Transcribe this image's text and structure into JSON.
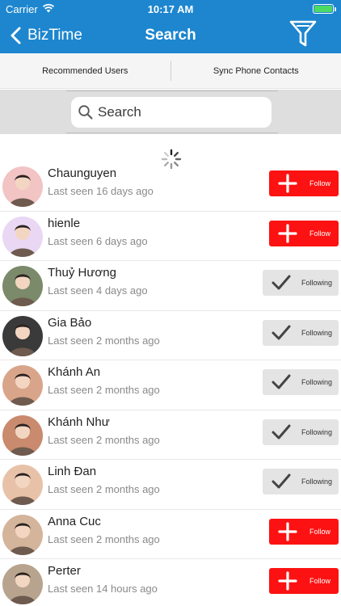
{
  "status_bar": {
    "carrier": "Carrier",
    "time": "10:17 AM"
  },
  "nav": {
    "back_label": "BizTime",
    "title": "Search"
  },
  "segments": [
    "Recommended Users",
    "Sync Phone Contacts"
  ],
  "search": {
    "placeholder": "Search"
  },
  "colors": {
    "header": "#1d86cf",
    "follow": "#fc1212",
    "following": "#e4e4e4"
  },
  "users": [
    {
      "name": "Chaunguyen",
      "last_seen": "Last seen 16 days ago",
      "action": "Follow",
      "avatar": "#f2c4c4"
    },
    {
      "name": "hienle",
      "last_seen": "Last seen 6 days ago",
      "action": "Follow",
      "avatar": "#e9d7f3"
    },
    {
      "name": "Thuỷ Hương",
      "last_seen": "Last seen 4 days ago",
      "action": "Following",
      "avatar": "#7a8a6a"
    },
    {
      "name": "Gia Bảo",
      "last_seen": "Last seen 2 months ago",
      "action": "Following",
      "avatar": "#3a3a3a"
    },
    {
      "name": "Khánh An",
      "last_seen": "Last seen 2 months ago",
      "action": "Following",
      "avatar": "#d9a58a"
    },
    {
      "name": "Khánh Như",
      "last_seen": "Last seen 2 months ago",
      "action": "Following",
      "avatar": "#c98a6e"
    },
    {
      "name": "Linh Đan",
      "last_seen": "Last seen 2 months ago",
      "action": "Following",
      "avatar": "#e8c2a8"
    },
    {
      "name": "Anna Cuc",
      "last_seen": "Last seen 2 months ago",
      "action": "Follow",
      "avatar": "#d4b49a"
    },
    {
      "name": "Perter",
      "last_seen": "Last seen 14 hours ago",
      "action": "Follow",
      "avatar": "#b8a48e"
    }
  ]
}
